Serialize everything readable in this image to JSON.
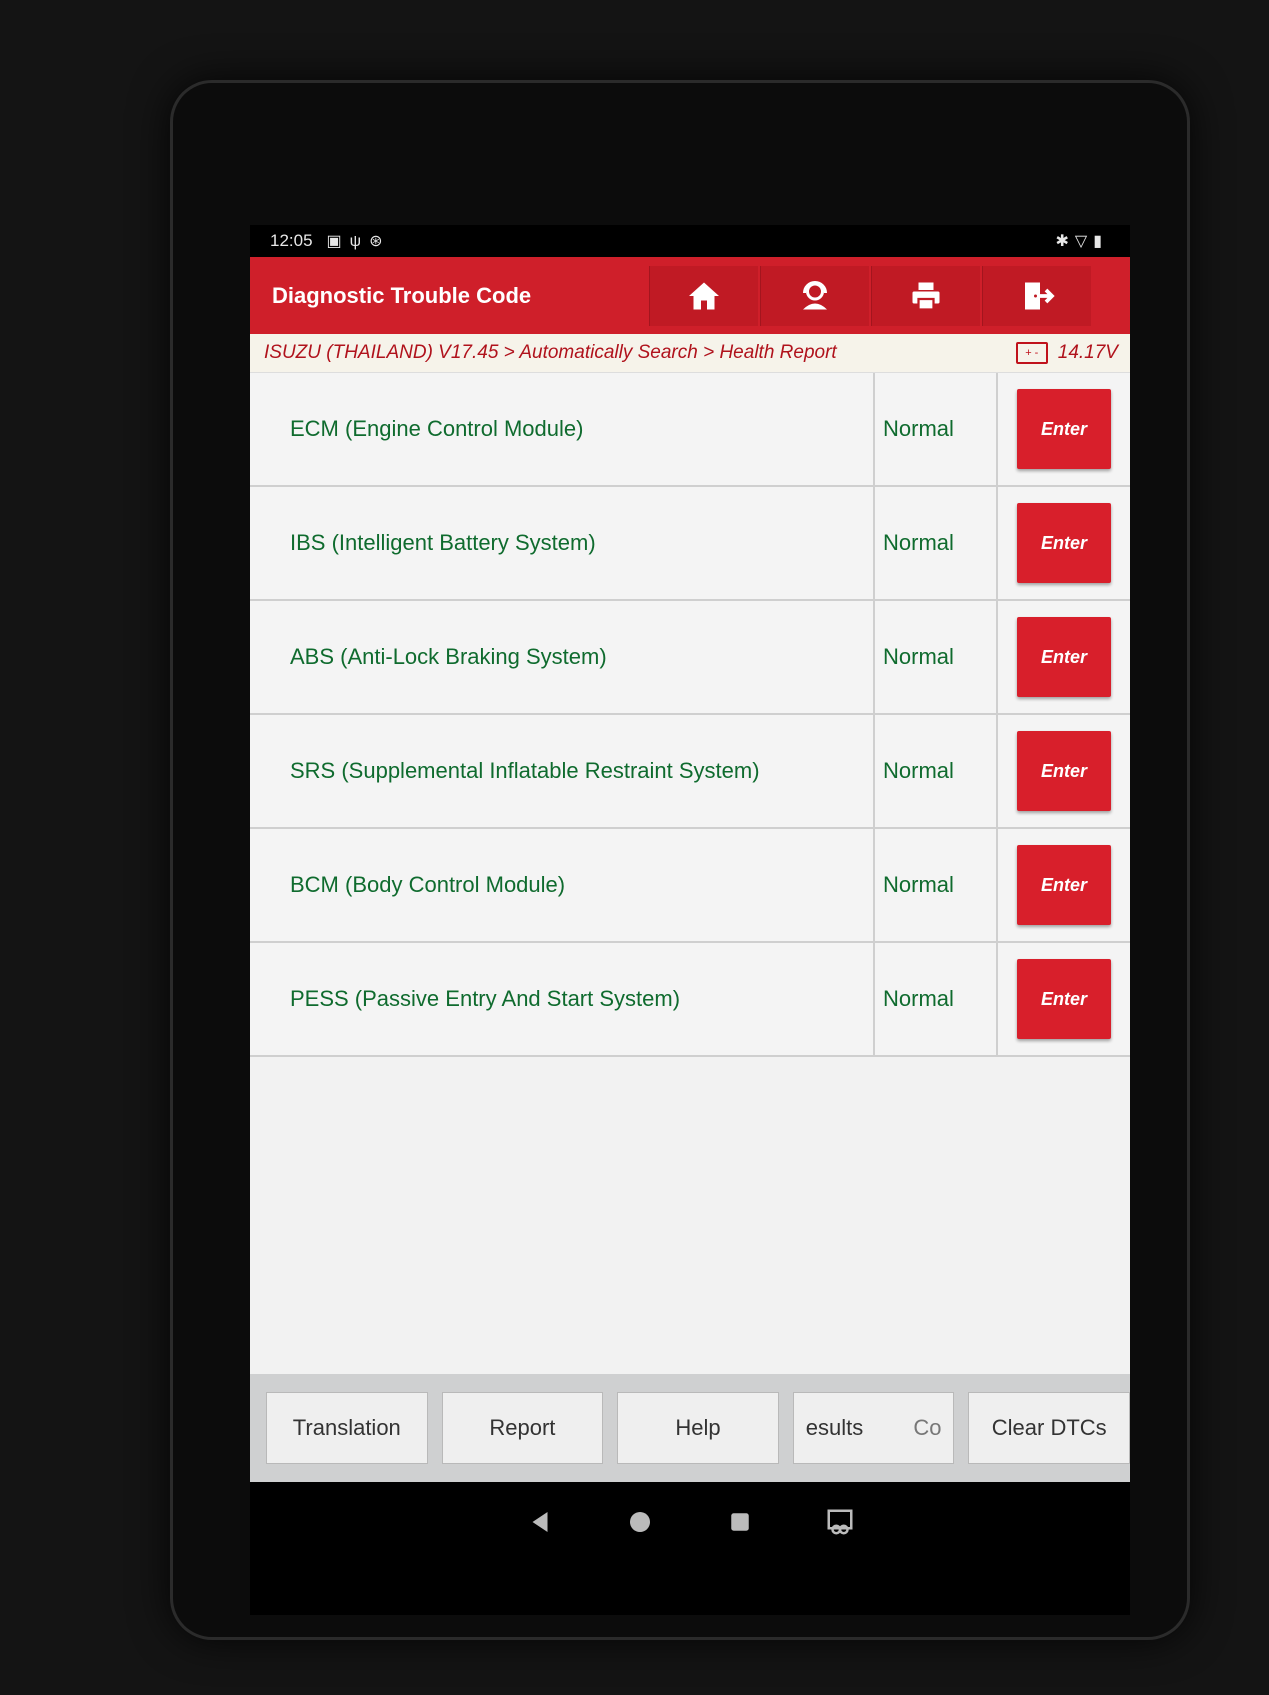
{
  "statusbar": {
    "time": "12:05",
    "left_icons": [
      "image-icon",
      "usb-icon",
      "settings-circle-icon"
    ],
    "right_icons": [
      "bluetooth-icon",
      "wifi-icon",
      "battery-icon"
    ]
  },
  "titlebar": {
    "title": "Diagnostic Trouble Code",
    "buttons": [
      "home-icon",
      "support-icon",
      "print-icon",
      "exit-icon"
    ]
  },
  "breadcrumb": {
    "path": "ISUZU (THAILAND) V17.45 > Automatically Search > Health Report",
    "voltage": "14.17V"
  },
  "systems": [
    {
      "name": "ECM (Engine Control Module)",
      "status": "Normal",
      "action": "Enter"
    },
    {
      "name": "IBS (Intelligent Battery System)",
      "status": "Normal",
      "action": "Enter"
    },
    {
      "name": "ABS (Anti-Lock Braking System)",
      "status": "Normal",
      "action": "Enter"
    },
    {
      "name": "SRS (Supplemental Inflatable Restraint System)",
      "status": "Normal",
      "action": "Enter"
    },
    {
      "name": "BCM (Body Control Module)",
      "status": "Normal",
      "action": "Enter"
    },
    {
      "name": "PESS (Passive Entry And Start System)",
      "status": "Normal",
      "action": "Enter"
    }
  ],
  "bottombar": {
    "translation": "Translation",
    "report": "Report",
    "help": "Help",
    "results": "esults",
    "partial": "Co",
    "clear": "Clear DTCs"
  },
  "colors": {
    "accent": "#cf1f2a",
    "text_green": "#0f6b2e",
    "breadcrumb_red": "#b0121c"
  }
}
